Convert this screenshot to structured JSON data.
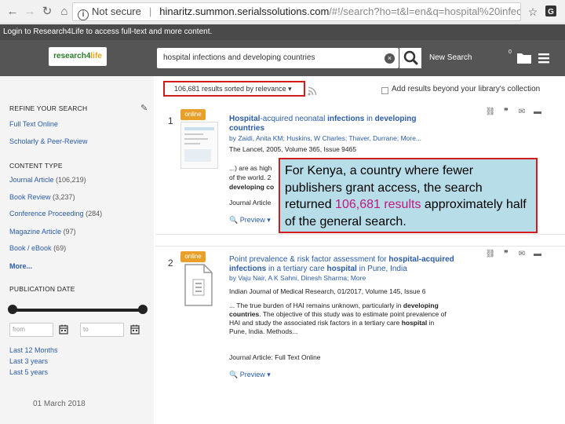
{
  "browser": {
    "url_prefix": "Not secure",
    "url_host": "hinaritz.summon.serialssolutions.com",
    "url_path": "/#!/search?ho=t&l=en&q=hospital%20infections%..."
  },
  "login_bar": "Login to Research4Life to access full-text and more content.",
  "header": {
    "logo_main": "research4",
    "logo_accent": "life",
    "search_query": "hospital infections and developing countries",
    "clear_glyph": "×",
    "new_search": "New Search",
    "folder_count": "0"
  },
  "sidebar": {
    "refine_heading": "REFINE YOUR SEARCH",
    "filters": [
      "Full Text Online",
      "Scholarly & Peer-Review"
    ],
    "content_type_heading": "CONTENT TYPE",
    "content_types": [
      {
        "label": "Journal Article",
        "count": "(106,219)"
      },
      {
        "label": "Book Review",
        "count": "(3,237)"
      },
      {
        "label": "Conference Proceeding",
        "count": "(284)"
      },
      {
        "label": "Magazine Article",
        "count": "(97)"
      },
      {
        "label": "Book / eBook",
        "count": "(69)"
      }
    ],
    "more": "More...",
    "pub_date_heading": "PUBLICATION DATE",
    "from_placeholder": "from",
    "to_placeholder": "to",
    "date_links": [
      "Last 12 Months",
      "Last 3 years",
      "Last 5 years"
    ]
  },
  "results_bar": {
    "sort_text": "106,681 results sorted by relevance ▾",
    "beyond_label": "Add results beyond your library's collection"
  },
  "results": [
    {
      "number": "1",
      "badge": "online",
      "title_parts": [
        "Hospital",
        "-acquired neonatal ",
        "infections",
        " in ",
        "developing",
        " ",
        "countries"
      ],
      "authors": "by Zaidi, Anita KM; Huskins, W Charles; Thaver, Durrane; More...",
      "source": "The Lancet, 2005, Volume 365, Issue 9465",
      "snippet_1": "...) are as high",
      "snippet_2": "of the world. 2",
      "snippet_3": "developing co",
      "type": "Journal Article",
      "preview": "Preview ▾"
    },
    {
      "number": "2",
      "badge": "online",
      "title_l1": "Point prevalence & risk factor assessment for ",
      "title_l1b": "hospital-acquired",
      "title_l2a": "infections",
      "title_l2b": " in a tertiary care ",
      "title_l2c": "hospital",
      "title_l2d": " in Pune, India",
      "authors": "by Vaju Nair, A K Sahni, Dinesh Sharma; More",
      "source": "Indian Journal of Medical Research, 01/2017, Volume 145, Issue 6",
      "snippet": [
        {
          "t": "... The true burden of HAI remains unknown, particularly in ",
          "b": "developing"
        },
        {
          "b": "countries",
          "t": ". The objective of this study was to estimate point prevalence of"
        },
        {
          "t": "HAI and study the associated risk factors in a tertiary care ",
          "b": "hospital",
          "t2": " in"
        },
        {
          "t": "Pune, India. Methods..."
        }
      ],
      "type": "Journal Article: Full Text Online",
      "preview": "Preview ▾"
    }
  ],
  "callout": {
    "text_1": "For Kenya, a country where fewer publishers grant access,  the search returned ",
    "highlight": "106,681 results",
    "text_2": " approximately half of the general search."
  },
  "footer_date": "01 March 2018",
  "colors": {
    "accent_red": "#d01c1c",
    "link_blue": "#2a5caa",
    "callout_bg": "#b7dde8",
    "highlight": "#c0187e",
    "badge": "#e8a02a"
  }
}
